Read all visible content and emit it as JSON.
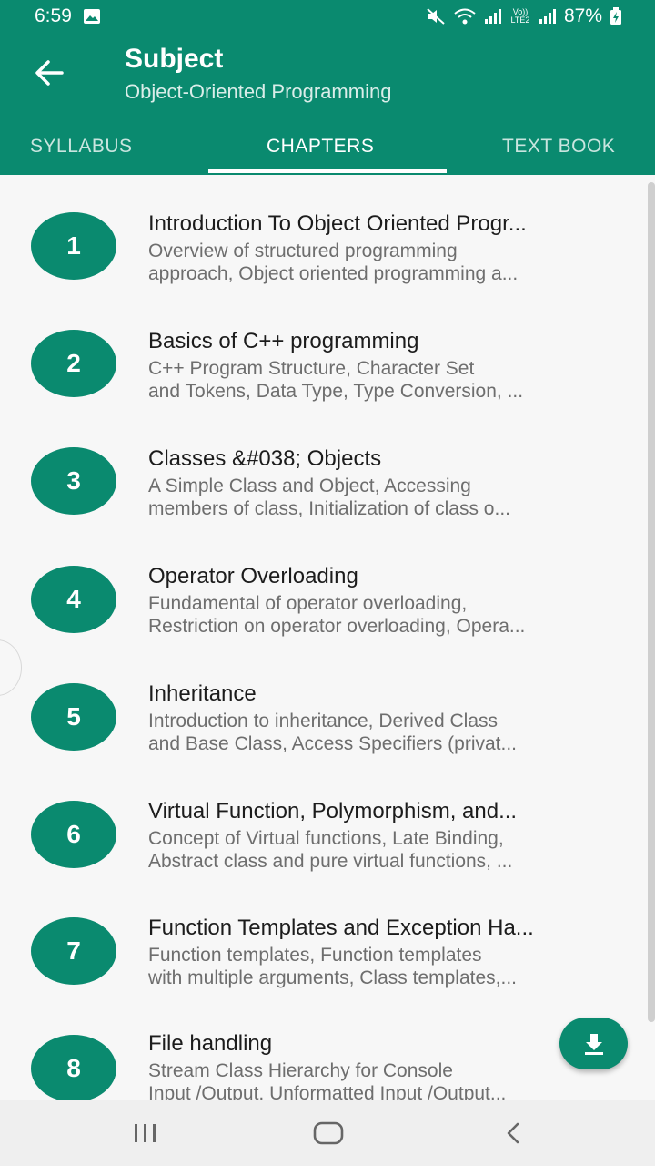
{
  "status": {
    "time": "6:59",
    "battery": "87%",
    "network_badge": "Vo)) LTE2"
  },
  "header": {
    "title": "Subject",
    "subtitle": "Object-Oriented Programming"
  },
  "tabs": [
    {
      "label": "SYLLABUS",
      "active": false
    },
    {
      "label": "CHAPTERS",
      "active": true
    },
    {
      "label": "TEXT BOOK",
      "active": false
    }
  ],
  "chapters": [
    {
      "number": "1",
      "title": "Introduction To Object Oriented Progr...",
      "desc1": "Overview of structured programming",
      "desc2": "approach, Object oriented programming a..."
    },
    {
      "number": "2",
      "title": "Basics of C++ programming",
      "desc1": "C++ Program Structure, Character Set",
      "desc2": "and Tokens, Data Type, Type Conversion, ..."
    },
    {
      "number": "3",
      "title": "Classes &#038; Objects",
      "desc1": "A Simple Class and Object, Accessing",
      "desc2": "members of class, Initialization of class o..."
    },
    {
      "number": "4",
      "title": "Operator Overloading",
      "desc1": "Fundamental of operator overloading,",
      "desc2": "Restriction on operator overloading, Opera..."
    },
    {
      "number": "5",
      "title": "Inheritance",
      "desc1": "Introduction to inheritance, Derived Class",
      "desc2": "and Base Class, Access Specifiers (privat..."
    },
    {
      "number": "6",
      "title": "Virtual Function, Polymorphism, and...",
      "desc1": "Concept of Virtual functions, Late Binding,",
      "desc2": "Abstract class and pure virtual functions, ..."
    },
    {
      "number": "7",
      "title": "Function Templates and Exception Ha...",
      "desc1": "Function templates, Function templates",
      "desc2": "with multiple arguments, Class templates,..."
    },
    {
      "number": "8",
      "title": "File handling",
      "desc1": "Stream Class Hierarchy for Console",
      "desc2": "Input /Output, Unformatted Input /Output..."
    }
  ],
  "icons": {
    "back": "arrow-left-icon",
    "download": "download-icon",
    "nav_recents": "recents-icon",
    "nav_home": "home-icon",
    "nav_back": "chevron-left-icon"
  },
  "colors": {
    "primary": "#0a8a6f",
    "on_primary": "#ffffff"
  }
}
